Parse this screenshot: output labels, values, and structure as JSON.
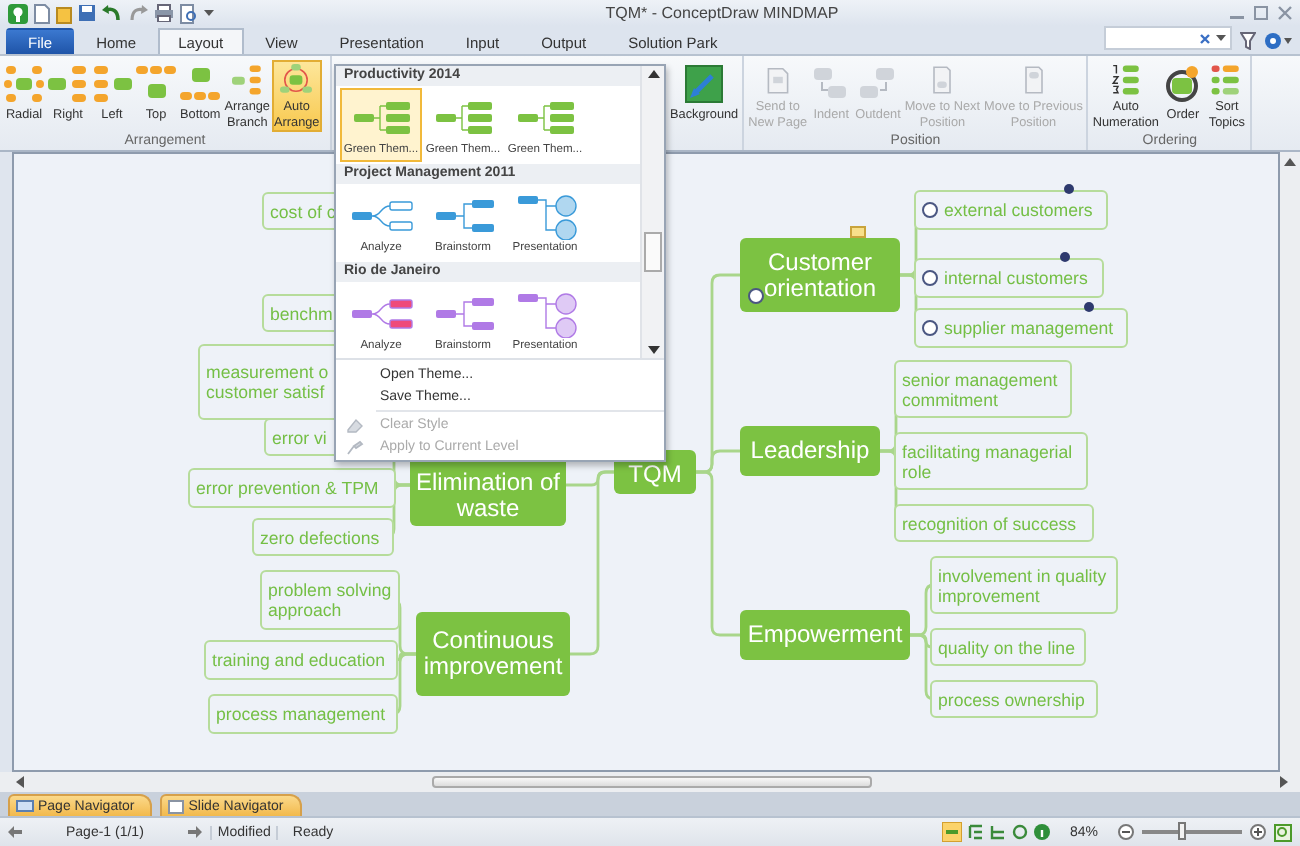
{
  "window": {
    "title": "TQM* - ConceptDraw MINDMAP"
  },
  "tabs": [
    {
      "label": "File",
      "kind": "file",
      "selected": false
    },
    {
      "label": "Home",
      "kind": "tab",
      "selected": false
    },
    {
      "label": "Layout",
      "kind": "tab",
      "selected": true
    },
    {
      "label": "View",
      "kind": "tab",
      "selected": false
    },
    {
      "label": "Presentation",
      "kind": "tab",
      "selected": false
    },
    {
      "label": "Input",
      "kind": "tab",
      "selected": false
    },
    {
      "label": "Output",
      "kind": "tab",
      "selected": false
    },
    {
      "label": "Solution Park",
      "kind": "tab",
      "selected": false
    }
  ],
  "ribbon": {
    "groups": [
      {
        "label": "Arrangement",
        "buttons": [
          {
            "label": "Radial",
            "kind": "radial",
            "selected": false,
            "disabled": false
          },
          {
            "label": "Right",
            "kind": "right",
            "selected": false,
            "disabled": false
          },
          {
            "label": "Left",
            "kind": "left",
            "selected": false,
            "disabled": false
          },
          {
            "label": "Top",
            "kind": "top",
            "selected": false,
            "disabled": false
          },
          {
            "label": "Bottom",
            "kind": "bottom",
            "selected": false,
            "disabled": false
          },
          {
            "label": "Arrange\nBranch",
            "kind": "branch",
            "selected": false,
            "disabled": false
          },
          {
            "label": "Auto\nArrange",
            "kind": "auto",
            "selected": true,
            "disabled": false
          }
        ]
      },
      {
        "buttons": [
          {
            "label": "Background",
            "kind": "background",
            "selected": false,
            "disabled": false
          }
        ]
      },
      {
        "label": "Position",
        "buttons": [
          {
            "label": "Send to\nNew Page",
            "kind": "page",
            "selected": false,
            "disabled": true
          },
          {
            "label": "Indent",
            "kind": "indent",
            "selected": false,
            "disabled": true
          },
          {
            "label": "Outdent",
            "kind": "outdent",
            "selected": false,
            "disabled": true
          },
          {
            "label": "Move to Next\nPosition",
            "kind": "next",
            "selected": false,
            "disabled": true
          },
          {
            "label": "Move to Previous\nPosition",
            "kind": "prev",
            "selected": false,
            "disabled": true
          }
        ]
      },
      {
        "label": "Ordering",
        "buttons": [
          {
            "label": "Auto\nNumeration",
            "kind": "numeration",
            "selected": false,
            "disabled": false
          },
          {
            "label": "Order",
            "kind": "order",
            "selected": false,
            "disabled": false
          },
          {
            "label": "Sort\nTopics",
            "kind": "sort",
            "selected": false,
            "disabled": false
          }
        ]
      }
    ]
  },
  "theme_menu": {
    "sections": [
      {
        "title": "Productivity 2014",
        "color": "#7cc242",
        "items": [
          {
            "label": "Green Them...",
            "kind": "standard",
            "selected": true
          },
          {
            "label": "Green Them...",
            "kind": "standard",
            "selected": false
          },
          {
            "label": "Green Them...",
            "kind": "standard",
            "selected": false
          }
        ]
      },
      {
        "title": "Project Management 2011",
        "color": "#3a9ad9",
        "items": [
          {
            "label": "Analyze",
            "kind": "analyze",
            "selected": false
          },
          {
            "label": "Brainstorm",
            "kind": "brainstorm",
            "selected": false
          },
          {
            "label": "Presentation",
            "kind": "presentation",
            "selected": false
          }
        ]
      },
      {
        "title": "Rio de Janeiro",
        "color": "#b07ae6",
        "items": [
          {
            "label": "Analyze",
            "kind": "analyze",
            "selected": false
          },
          {
            "label": "Brainstorm",
            "kind": "brainstorm",
            "selected": false
          },
          {
            "label": "Presentation",
            "kind": "presentation",
            "selected": false
          }
        ]
      }
    ],
    "commands": [
      {
        "label": "Open Theme...",
        "kind": "plain",
        "disabled": false
      },
      {
        "label": "Save Theme...",
        "kind": "plain",
        "disabled": false
      },
      {
        "label": "Clear Style",
        "kind": "clear",
        "disabled": true
      },
      {
        "label": "Apply to Current Level",
        "kind": "apply",
        "disabled": true
      }
    ]
  },
  "mindmap": {
    "center": {
      "label": "TQM"
    },
    "topics": [
      {
        "label": "Customer\norientation",
        "kind": "task",
        "checked": false,
        "note": true,
        "children": [
          {
            "label": "external customers",
            "kind": "task",
            "checked": false,
            "marker": true
          },
          {
            "label": "internal customers",
            "kind": "task",
            "checked": false,
            "marker": true
          },
          {
            "label": "supplier management",
            "kind": "task",
            "checked": false,
            "marker": true
          }
        ]
      },
      {
        "label": "Leadership",
        "kind": "plain",
        "children": [
          {
            "label": "senior management\ncommitment",
            "kind": "plain"
          },
          {
            "label": "facilitating managerial\nrole",
            "kind": "plain"
          },
          {
            "label": "recognition of success",
            "kind": "plain"
          }
        ]
      },
      {
        "label": "Empowerment",
        "kind": "plain",
        "children": [
          {
            "label": "involvement in quality\nimprovement",
            "kind": "plain"
          },
          {
            "label": "quality on the line",
            "kind": "plain"
          },
          {
            "label": "process ownership",
            "kind": "plain"
          }
        ]
      },
      {
        "label": "Elimination of\nwaste",
        "kind": "plain",
        "children": [
          {
            "label": "error vi",
            "kind": "plain"
          },
          {
            "label": "error prevention & TPM",
            "kind": "plain"
          },
          {
            "label": "zero defections",
            "kind": "plain"
          }
        ]
      },
      {
        "label": "Continuous\nimprovement",
        "kind": "plain",
        "children": [
          {
            "label": "problem solving\napproach",
            "kind": "plain"
          },
          {
            "label": "training and education",
            "kind": "plain"
          },
          {
            "label": "process management",
            "kind": "plain"
          }
        ]
      }
    ],
    "other_subtopics": [
      {
        "label": "cost of c"
      },
      {
        "label": "benchm"
      },
      {
        "label": "measurement o\ncustomer satisf"
      }
    ]
  },
  "navigator_tabs": [
    {
      "label": "Page Navigator",
      "kind": "page"
    },
    {
      "label": "Slide Navigator",
      "kind": "slide"
    }
  ],
  "status_bar": {
    "page": "Page-1 (1/1)",
    "state": "Modified",
    "message": "Ready",
    "zoom": "84%",
    "zoom_slider": {
      "level": 0.4
    }
  }
}
